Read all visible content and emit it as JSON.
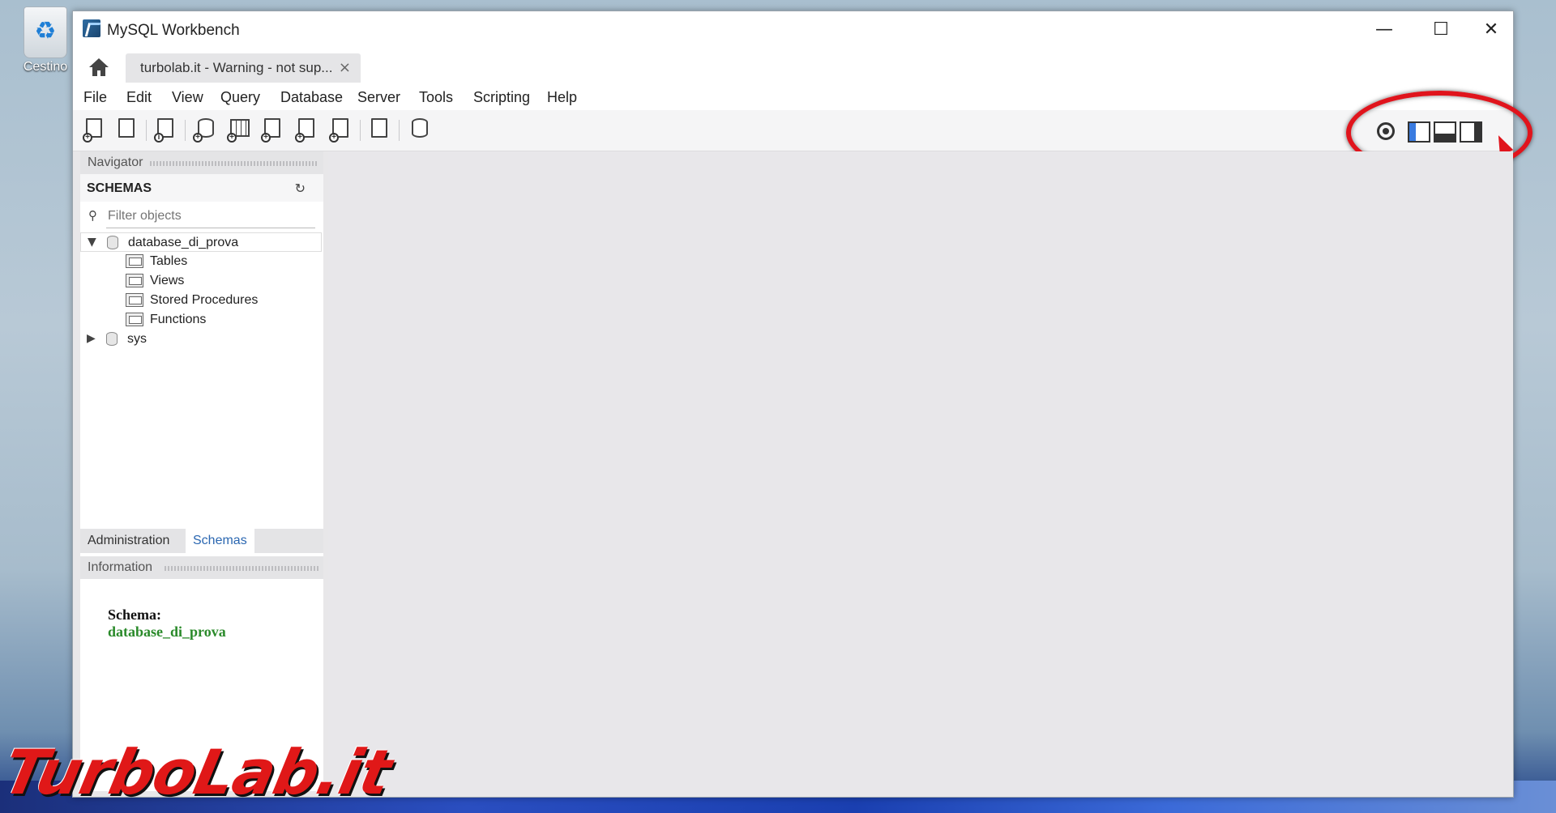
{
  "desktop": {
    "recycle_bin_label": "Cestino"
  },
  "window": {
    "title": "MySQL Workbench"
  },
  "tabs": [
    {
      "label": "turbolab.it - Warning - not sup..."
    }
  ],
  "menu": [
    "File",
    "Edit",
    "View",
    "Query",
    "Database",
    "Server",
    "Tools",
    "Scripting",
    "Help"
  ],
  "toolbar": {
    "icons": [
      "new-sql-tab-icon",
      "open-sql-script-icon",
      "inspect-icon",
      "create-schema-icon",
      "create-table-icon",
      "create-view-icon",
      "create-procedure-icon",
      "create-function-icon",
      "search-table-data-icon",
      "reconnect-icon"
    ]
  },
  "navigator": {
    "header": "Navigator",
    "schemas_title": "SCHEMAS",
    "filter_placeholder": "Filter objects",
    "tree": {
      "db1": "database_di_prova",
      "children": [
        "Tables",
        "Views",
        "Stored Procedures",
        "Functions"
      ],
      "db2": "sys"
    },
    "tabs": [
      "Administration",
      "Schemas"
    ],
    "active_tab": "Schemas"
  },
  "information": {
    "header": "Information",
    "schema_key": "Schema:",
    "schema_value": "database_di_prova"
  },
  "watermark": "TurboLab.it",
  "colors": {
    "accent": "#2b67b1",
    "schema_value": "#2a8a2a",
    "highlight": "#e0141c"
  }
}
